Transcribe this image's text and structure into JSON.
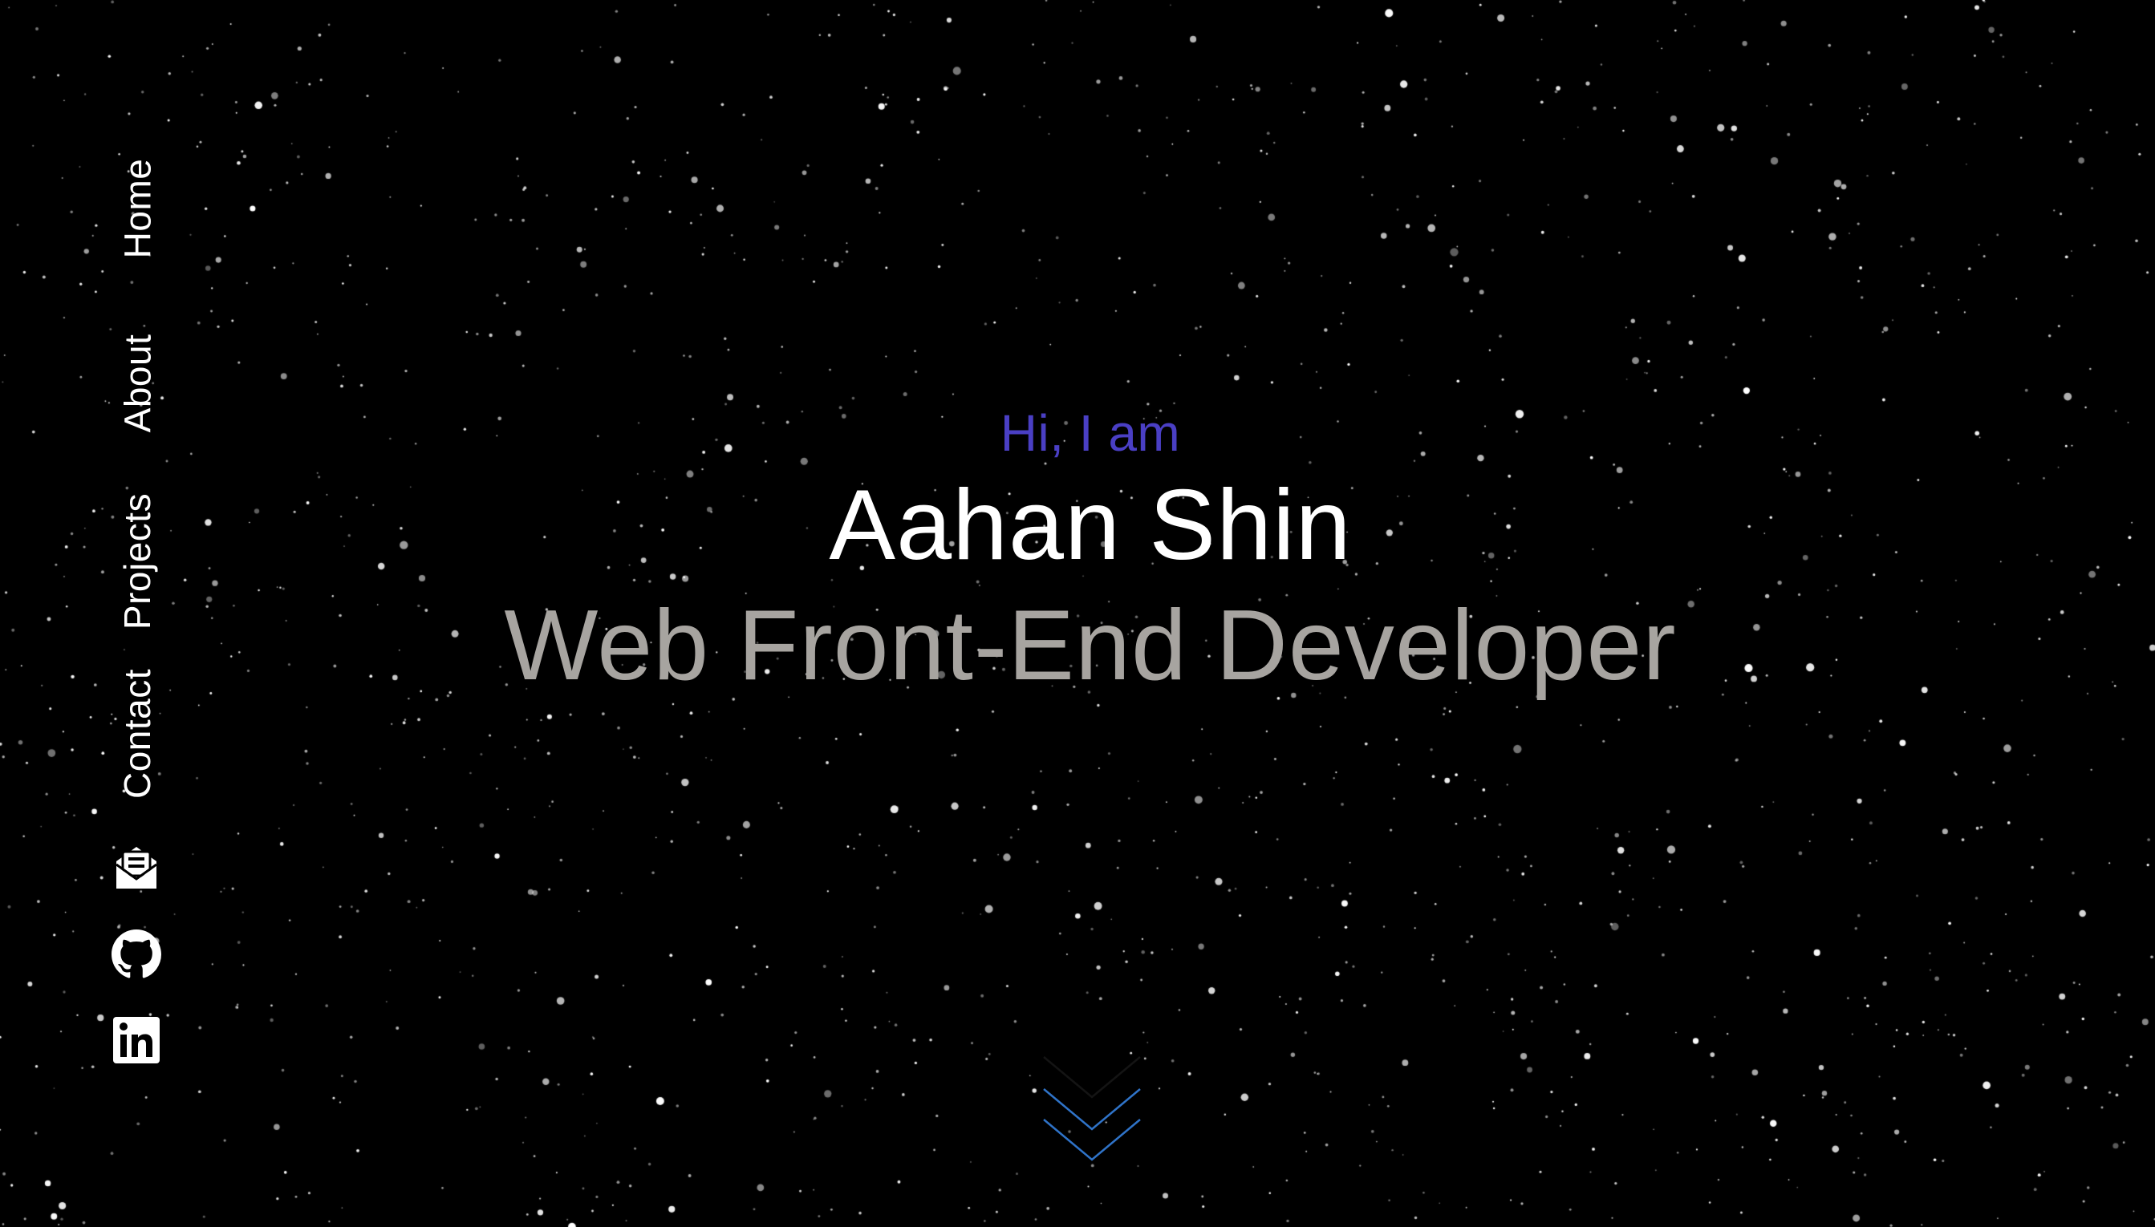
{
  "nav": {
    "items": [
      {
        "label": "Home"
      },
      {
        "label": "About"
      },
      {
        "label": "Projects"
      },
      {
        "label": "Contact"
      }
    ]
  },
  "social": {
    "icons": [
      "mail-icon",
      "github-icon",
      "linkedin-icon"
    ]
  },
  "hero": {
    "greeting": "Hi, I am",
    "name": "Aahan Shin",
    "role": "Web Front-End Developer"
  },
  "scroll_indicator": {
    "icon": "double-chevron-down-icon"
  },
  "colors": {
    "background": "#000000",
    "accent": "#4a3fc4",
    "role_text": "#a7a4a0",
    "chevron": "#2f73c8"
  }
}
